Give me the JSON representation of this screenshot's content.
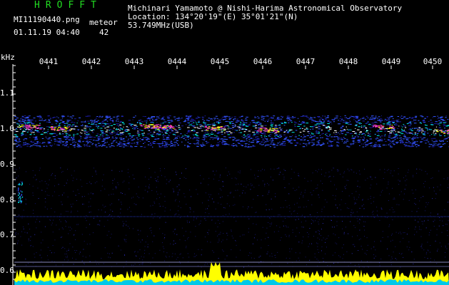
{
  "header": {
    "app_title": "HROFFT",
    "filename": "MI11190440.png",
    "datetime": "01.11.19 04:40",
    "meteor_label": "meteor",
    "meteor_count": "42"
  },
  "station": {
    "observer": "Michinari Yamamoto @ Nishi-Harima Astronomical Observatory",
    "location": "Location: 134°20'19\"(E) 35°01'21\"(N)",
    "frequency": "53.749MHz(USB)"
  },
  "axes": {
    "unit": "kHz",
    "time_ticks": [
      "0441",
      "0442",
      "0443",
      "0444",
      "0445",
      "0446",
      "0447",
      "0448",
      "0449",
      "0450"
    ],
    "freq_ticks": [
      "1.1",
      "1.0",
      "0.9",
      "0.8",
      "0.7",
      "0.6"
    ]
  },
  "colors": {
    "background": "#000000",
    "title_green": "#22dd22",
    "tick_yellow": "#ffff00",
    "signal_colors": [
      "#1a1aa0",
      "#3355ff",
      "#00e5e5",
      "#ffffff",
      "#ff33cc",
      "#ffff00"
    ]
  }
}
